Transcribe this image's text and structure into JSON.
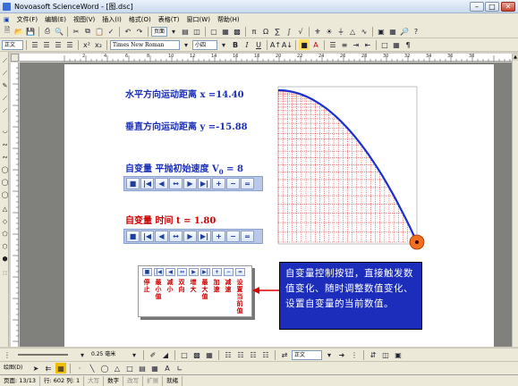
{
  "window": {
    "title": "Novoasoft ScienceWord - [图.dsc]",
    "min": "–",
    "max": "□",
    "close": "✕"
  },
  "menus": [
    "文件(F)",
    "编辑(E)",
    "视图(V)",
    "插入(I)",
    "格式(O)",
    "表格(T)",
    "窗口(W)",
    "帮助(H)"
  ],
  "toolbar1": {
    "page_label": "页面"
  },
  "toolbar2": {
    "style": "正文",
    "font": "Times New Roman",
    "size": "小四",
    "bold": "B",
    "italic": "I",
    "underline": "U"
  },
  "ruler": {
    "numbers": [
      "2",
      "4",
      "6",
      "8",
      "10",
      "12",
      "14",
      "16",
      "18",
      "20",
      "22",
      "24",
      "26",
      "28",
      "30",
      "32",
      "34",
      "36",
      "38"
    ]
  },
  "doc": {
    "horizontal": "水平方向运动距离  x =14.40",
    "vertical": "垂直方向运动距离  y =-15.88",
    "var1_prefix": "自变量  平抛初始速度  V",
    "var1_sub": "0",
    "var1_suffix": " = 8",
    "var2": "自变量  时间  t = 1.80",
    "control_buttons": [
      "■",
      "|◀",
      "◀",
      "↔",
      "▶",
      "▶|",
      "+",
      "−",
      "="
    ]
  },
  "legend": {
    "buttons": [
      "■",
      "|◀",
      "◀",
      "↔",
      "▶",
      "▶|",
      "+",
      "−",
      "="
    ],
    "labels": [
      "停止",
      "最小值",
      "减小",
      "双向",
      "增大",
      "最大值",
      "加速",
      "减速",
      "设置当前值"
    ]
  },
  "note": "自变量控制按钮，直接触发数值变化、随时调整数值变化、设置自变量的当前数值。",
  "bottom_toolbar1": {
    "line_width": "0.25 毫米",
    "style": "正文"
  },
  "bottom_toolbar2": {
    "draw_label": "绘图(D)"
  },
  "statusbar": [
    "页面: 13/13",
    "行: 602 列: 1",
    "大写",
    "数字",
    "改写",
    "扩展",
    "就绪"
  ],
  "colors": {
    "text_blue": "#1a2fb5",
    "text_red": "#cc0000",
    "curve": "#1a2fd0",
    "dash": "#e03030",
    "ball": "#f07020",
    "note_bg": "#1c2dbb"
  }
}
